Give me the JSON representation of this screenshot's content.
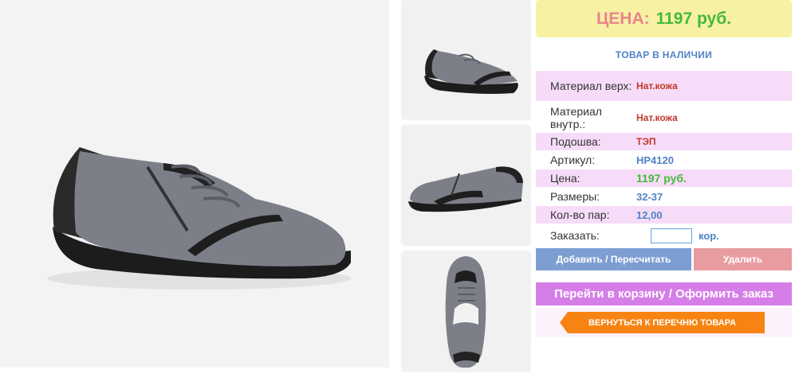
{
  "price": {
    "label": "ЦЕНА:",
    "value": "1197 руб."
  },
  "stock_status": "ТОВАР В НАЛИЧИИ",
  "specs": [
    {
      "key": "Материал верх:",
      "value": "Нат.кожа"
    },
    {
      "key": "Материал внутр.:",
      "value": "Нат.кожа"
    },
    {
      "key": "Подошва:",
      "value": "ТЭП"
    },
    {
      "key": "Артикул:",
      "value": "HP4120"
    },
    {
      "key": "Цена:",
      "value": "1197 руб."
    },
    {
      "key": "Размеры:",
      "value": "32-37"
    },
    {
      "key": "Кол-во пар:",
      "value": "12,00"
    }
  ],
  "order": {
    "label": "Заказать:",
    "quantity": "",
    "unit": "кор."
  },
  "buttons": {
    "add": "Добавить / Пересчитать",
    "delete": "Удалить",
    "cart": "Перейти в корзину / Оформить заказ",
    "back": "ВЕРНУТЬСЯ К ПЕРЕЧНЮ ТОВАРА"
  },
  "colors": {
    "price_bg": "#f7f1a3",
    "price_label": "#e8858c",
    "price_value": "#45b93a",
    "accent_blue": "#4f82c6",
    "row_pink": "#f6dcf8",
    "add_button": "#7d9ed2",
    "delete_button": "#e89c9f",
    "cart_button": "#d67ee8",
    "back_button": "#f78412"
  },
  "images": {
    "main": "shoe-side-view",
    "thumbnails": [
      "shoe-side-view-small",
      "shoe-inner-side-view",
      "shoe-top-view"
    ]
  }
}
